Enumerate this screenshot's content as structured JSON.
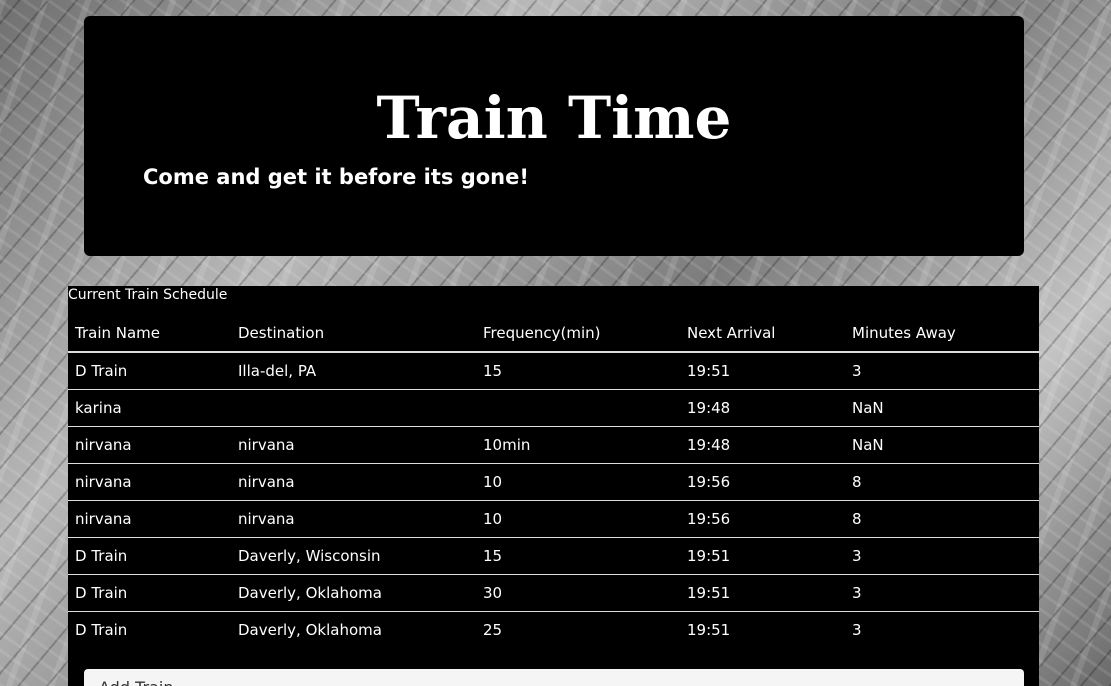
{
  "header": {
    "title": "Train Time",
    "tagline": "Come and get it before its gone!"
  },
  "schedule": {
    "title": "Current Train Schedule",
    "columns": [
      "Train Name",
      "Destination",
      "Frequency(min)",
      "Next Arrival",
      "Minutes Away"
    ],
    "rows": [
      [
        "D Train",
        "Illa-del, PA",
        "15",
        "19:51",
        "3"
      ],
      [
        "karina",
        "",
        "",
        "19:48",
        "NaN"
      ],
      [
        "nirvana",
        "nirvana",
        "10min",
        "19:48",
        "NaN"
      ],
      [
        "nirvana",
        "nirvana",
        "10",
        "19:56",
        "8"
      ],
      [
        "nirvana",
        "nirvana",
        "10",
        "19:56",
        "8"
      ],
      [
        "D Train",
        "Daverly, Wisconsin",
        "15",
        "19:51",
        "3"
      ],
      [
        "D Train",
        "Daverly, Oklahoma",
        "30",
        "19:51",
        "3"
      ],
      [
        "D Train",
        "Daverly, Oklahoma",
        "25",
        "19:51",
        "3"
      ]
    ]
  },
  "add_train": {
    "title": "Add Train"
  },
  "colors": {
    "panel": "#000000",
    "text": "#ffffff",
    "row_border": "#dddddd",
    "add_panel": "#f5f5f5"
  }
}
